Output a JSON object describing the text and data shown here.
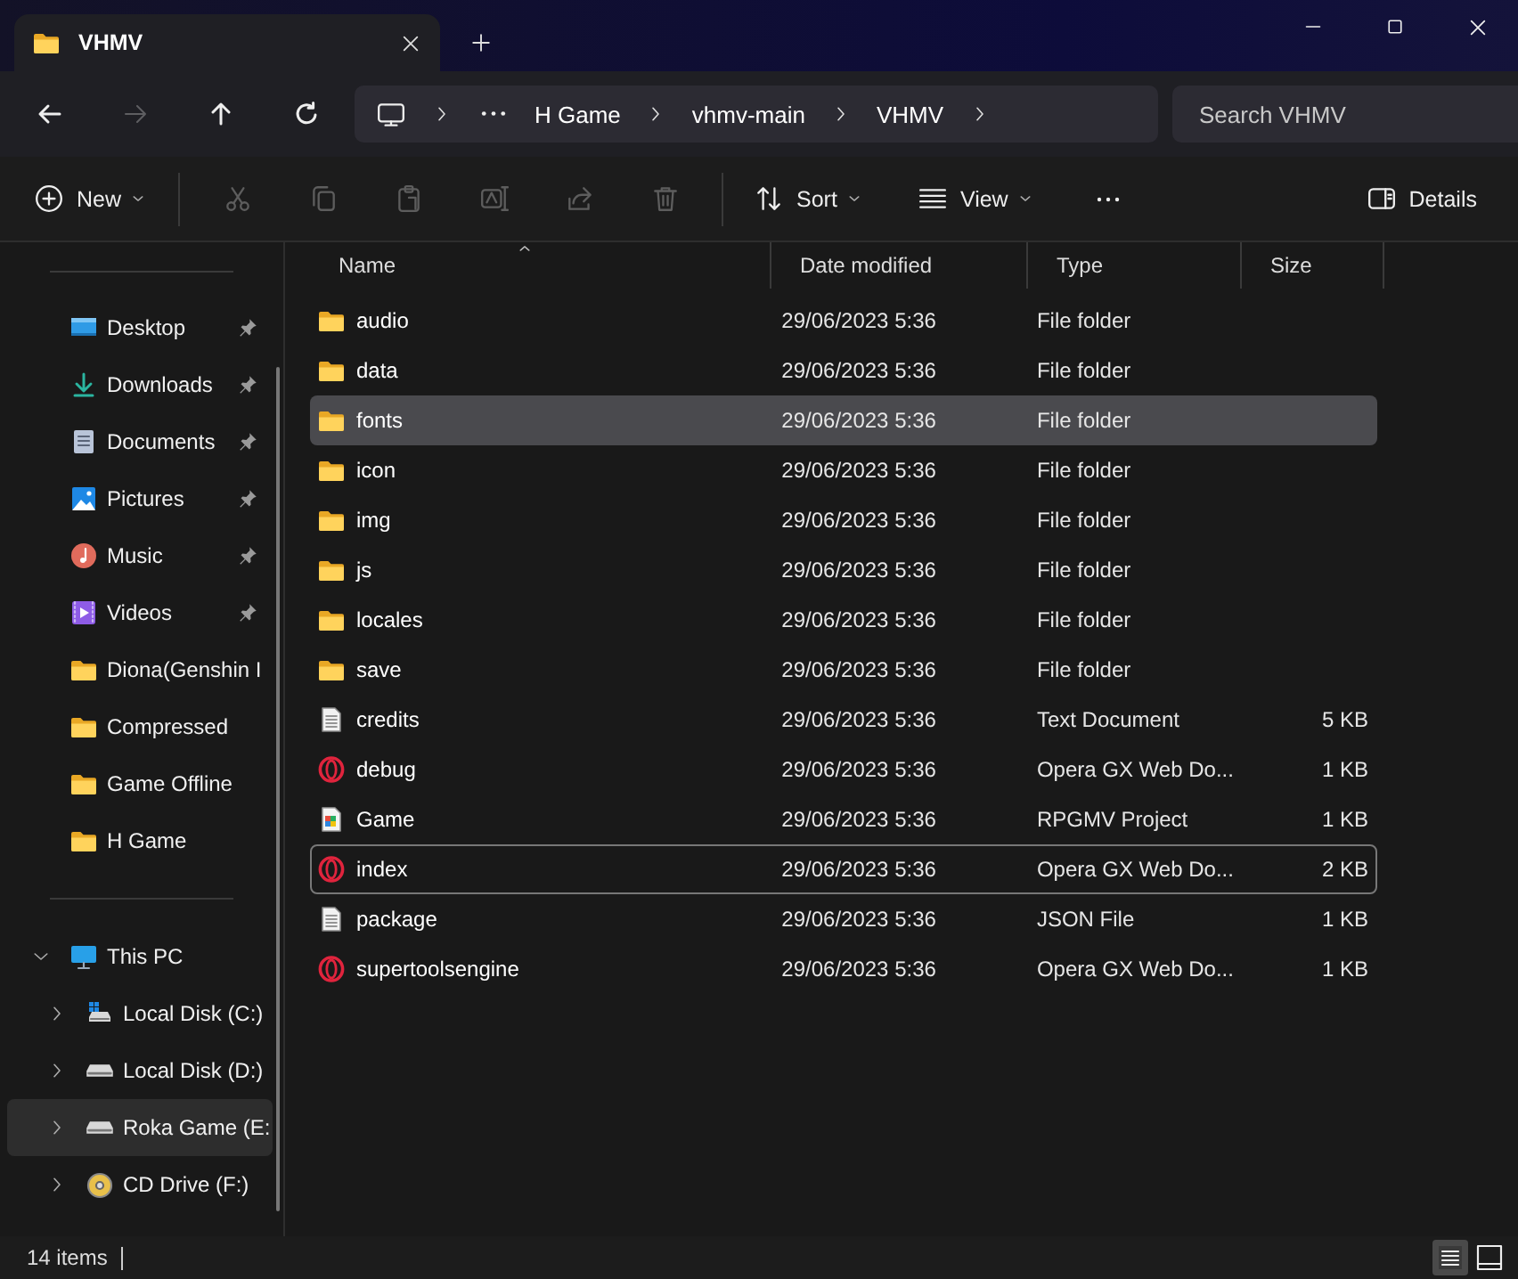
{
  "tabs": [
    {
      "title": "VHMV",
      "selected": true
    }
  ],
  "nav_buttons": [
    {
      "kind": "back",
      "disabled": false
    },
    {
      "kind": "forward",
      "disabled": true
    },
    {
      "kind": "up",
      "disabled": false
    },
    {
      "kind": "refresh",
      "disabled": false
    }
  ],
  "address_bar": {
    "crumbs": [
      "H Game",
      "vhmv-main",
      "VHMV"
    ]
  },
  "search": {
    "placeholder": "Search VHMV"
  },
  "command_bar": [
    {
      "kind": "new",
      "label": "New",
      "disabled": false
    },
    {
      "kind": "cut",
      "disabled": true
    },
    {
      "kind": "copy",
      "disabled": true
    },
    {
      "kind": "paste",
      "disabled": true
    },
    {
      "kind": "rename",
      "disabled": true
    },
    {
      "kind": "share",
      "disabled": true
    },
    {
      "kind": "delete",
      "disabled": true
    },
    {
      "kind": "sort",
      "label": "Sort",
      "disabled": false
    },
    {
      "kind": "view",
      "label": "View",
      "disabled": false
    },
    {
      "kind": "more",
      "disabled": false
    },
    {
      "kind": "details",
      "label": "Details",
      "disabled": false
    }
  ],
  "sidebar": {
    "quick_access": [
      {
        "label": "Desktop",
        "kind": "desktop",
        "pinned": true,
        "selected": false
      },
      {
        "label": "Downloads",
        "kind": "downloads",
        "pinned": true,
        "selected": false
      },
      {
        "label": "Documents",
        "kind": "documents",
        "pinned": true,
        "selected": false
      },
      {
        "label": "Pictures",
        "kind": "pictures",
        "pinned": true,
        "selected": false
      },
      {
        "label": "Music",
        "kind": "music",
        "pinned": true,
        "selected": false
      },
      {
        "label": "Videos",
        "kind": "videos",
        "pinned": true,
        "selected": false
      },
      {
        "label": "Diona(Genshin I",
        "kind": "folder",
        "pinned": false,
        "selected": false
      },
      {
        "label": "Compressed",
        "kind": "folder",
        "pinned": false,
        "selected": false
      },
      {
        "label": "Game Offline",
        "kind": "folder",
        "pinned": false,
        "selected": false
      },
      {
        "label": "H Game",
        "kind": "folder",
        "pinned": false,
        "selected": false
      }
    ],
    "this_pc": {
      "label": "This PC",
      "kind": "pc",
      "expanded": true,
      "selected": false,
      "children": [
        {
          "label": "Local Disk (C:)",
          "kind": "system-disk",
          "expanded": false,
          "selected": false
        },
        {
          "label": "Local Disk (D:)",
          "kind": "disk",
          "expanded": false,
          "selected": false
        },
        {
          "label": "Roka Game (E:",
          "kind": "disk",
          "expanded": false,
          "selected": true
        },
        {
          "label": "CD Drive (F:)",
          "kind": "cd",
          "expanded": false,
          "selected": false
        }
      ]
    }
  },
  "file_list": {
    "columns": [
      {
        "label": "Name",
        "sorted": true
      },
      {
        "label": "Date modified",
        "sorted": false
      },
      {
        "label": "Type",
        "sorted": false
      },
      {
        "label": "Size",
        "sorted": false
      }
    ],
    "rows": [
      {
        "name": "audio",
        "kind": "folder",
        "date": "29/06/2023 5:36",
        "type": "File folder",
        "selected": false,
        "focused": false
      },
      {
        "name": "data",
        "kind": "folder",
        "date": "29/06/2023 5:36",
        "type": "File folder",
        "selected": false,
        "focused": false
      },
      {
        "name": "fonts",
        "kind": "folder",
        "date": "29/06/2023 5:36",
        "type": "File folder",
        "selected": true,
        "focused": false
      },
      {
        "name": "icon",
        "kind": "folder",
        "date": "29/06/2023 5:36",
        "type": "File folder",
        "selected": false,
        "focused": false
      },
      {
        "name": "img",
        "kind": "folder",
        "date": "29/06/2023 5:36",
        "type": "File folder",
        "selected": false,
        "focused": false
      },
      {
        "name": "js",
        "kind": "folder",
        "date": "29/06/2023 5:36",
        "type": "File folder",
        "selected": false,
        "focused": false
      },
      {
        "name": "locales",
        "kind": "folder",
        "date": "29/06/2023 5:36",
        "type": "File folder",
        "selected": false,
        "focused": false
      },
      {
        "name": "save",
        "kind": "folder",
        "date": "29/06/2023 5:36",
        "type": "File folder",
        "selected": false,
        "focused": false
      },
      {
        "name": "credits",
        "kind": "text",
        "date": "29/06/2023 5:36",
        "type": "Text Document",
        "size": "5 KB",
        "selected": false,
        "focused": false
      },
      {
        "name": "debug",
        "kind": "opera",
        "date": "29/06/2023 5:36",
        "type": "Opera GX Web Do...",
        "size": "1 KB",
        "selected": false,
        "focused": false
      },
      {
        "name": "Game",
        "kind": "rpgmv",
        "date": "29/06/2023 5:36",
        "type": "RPGMV Project",
        "size": "1 KB",
        "selected": false,
        "focused": false
      },
      {
        "name": "index",
        "kind": "opera",
        "date": "29/06/2023 5:36",
        "type": "Opera GX Web Do...",
        "size": "2 KB",
        "selected": false,
        "focused": true
      },
      {
        "name": "package",
        "kind": "text",
        "date": "29/06/2023 5:36",
        "type": "JSON File",
        "size": "1 KB",
        "selected": false,
        "focused": false
      },
      {
        "name": "supertoolsengine",
        "kind": "opera",
        "date": "29/06/2023 5:36",
        "type": "Opera GX Web Do...",
        "size": "1 KB",
        "selected": false,
        "focused": false
      }
    ]
  },
  "status_bar": {
    "item_count": "14 items",
    "view_buttons": [
      {
        "kind": "details",
        "selected": true
      },
      {
        "kind": "preview",
        "selected": false
      }
    ]
  }
}
